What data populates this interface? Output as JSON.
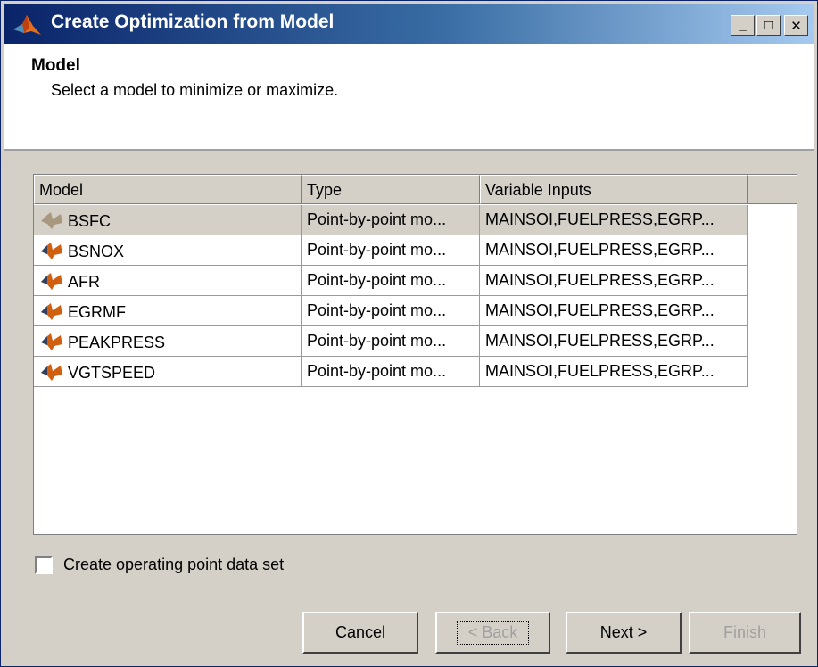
{
  "window": {
    "title": "Create Optimization from Model",
    "controls": {
      "minimize": "_",
      "maximize": "□",
      "close": "✕"
    }
  },
  "header": {
    "title": "Model",
    "description": "Select a model to minimize or maximize."
  },
  "table": {
    "columns": [
      "Model",
      "Type",
      "Variable Inputs"
    ],
    "rows": [
      {
        "model": "BSFC",
        "type": "Point-by-point mo...",
        "inputs": "MAINSOI,FUELPRESS,EGRP..."
      },
      {
        "model": "BSNOX",
        "type": "Point-by-point mo...",
        "inputs": "MAINSOI,FUELPRESS,EGRP..."
      },
      {
        "model": "AFR",
        "type": "Point-by-point mo...",
        "inputs": "MAINSOI,FUELPRESS,EGRP..."
      },
      {
        "model": "EGRMF",
        "type": "Point-by-point mo...",
        "inputs": "MAINSOI,FUELPRESS,EGRP..."
      },
      {
        "model": "PEAKPRESS",
        "type": "Point-by-point mo...",
        "inputs": "MAINSOI,FUELPRESS,EGRP..."
      },
      {
        "model": "VGTSPEED",
        "type": "Point-by-point mo...",
        "inputs": "MAINSOI,FUELPRESS,EGRP..."
      }
    ],
    "selected_row": 0
  },
  "checkbox": {
    "label": "Create operating point data set",
    "checked": false
  },
  "buttons": {
    "cancel": "Cancel",
    "back": "< Back",
    "next": "Next >",
    "finish": "Finish"
  },
  "colors": {
    "title_gradient_start": "#0a246a",
    "title_gradient_end": "#a6caf0",
    "face": "#d4d0c8",
    "disabled_text": "#a0a0a0"
  },
  "icons": {
    "app": "matlab-membrane-icon",
    "model": "model-butterfly-icon"
  }
}
